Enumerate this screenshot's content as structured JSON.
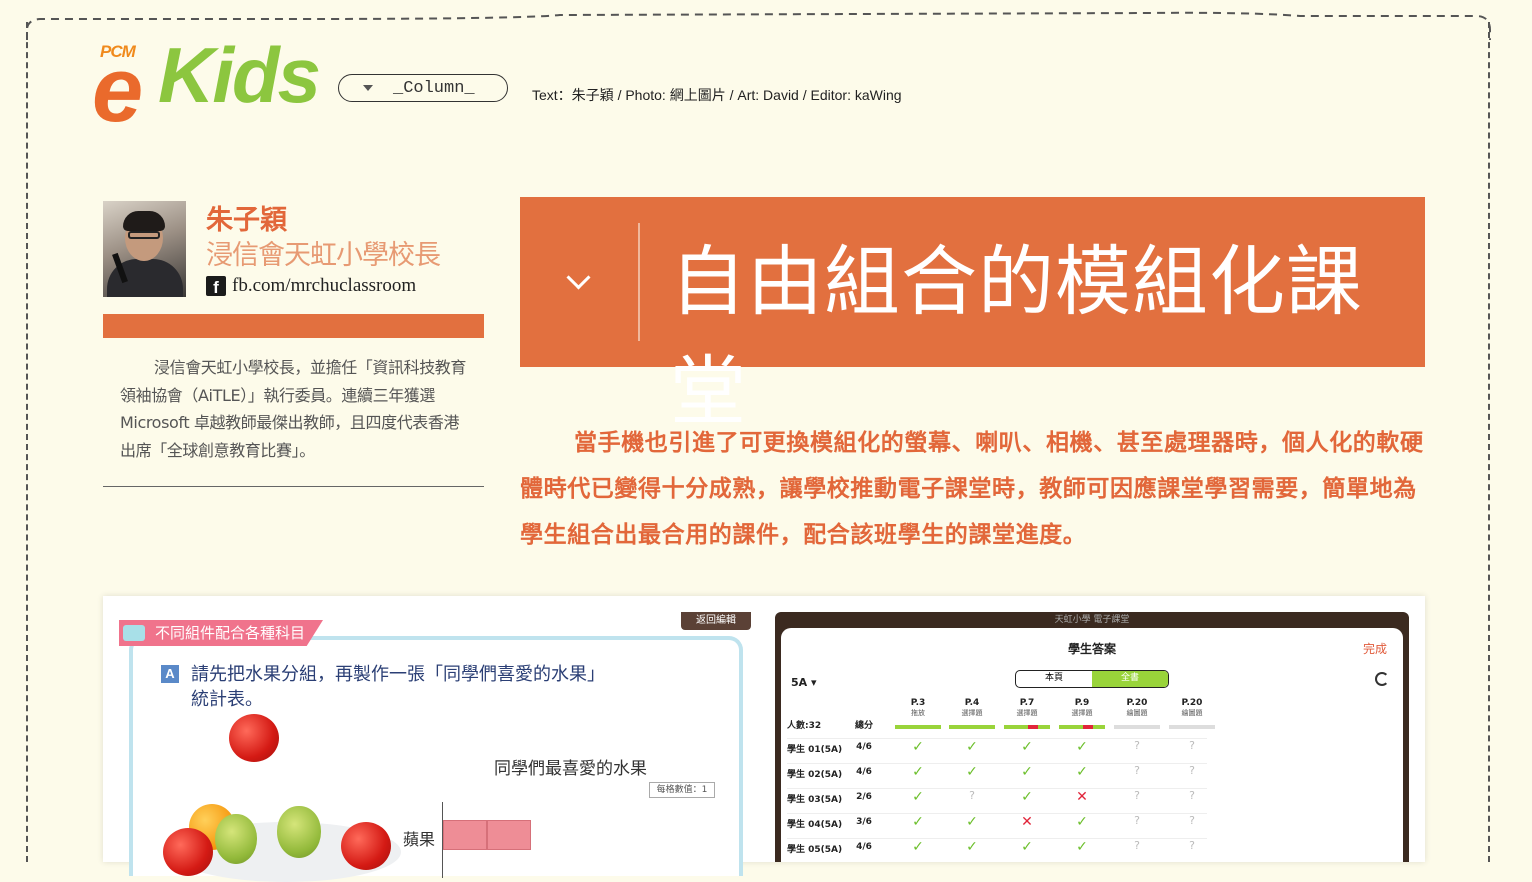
{
  "header": {
    "logo_prefix": "PCM",
    "logo_e": "e",
    "logo_kids": "Kids",
    "column_label": "_Column_",
    "credits": "Text：朱子穎 / Photo: 網上圖片 / Art: David / Editor: kaWing"
  },
  "author": {
    "name": "朱子穎",
    "role": "浸信會天虹小學校長",
    "fb_icon": "f",
    "fb_link": "fb.com/mrchuclassroom",
    "bio": "浸信會天虹小學校長，並擔任「資訊科技教育領袖協會（AiTLE）」執行委員。連續三年獲選 Microsoft 卓越教師最傑出教師，且四度代表香港出席「全球創意教育比賽」。"
  },
  "article": {
    "title": "自由組合的模組化課堂",
    "lead": "當手機也引進了可更換模組化的螢幕、喇叭、相機、甚至處理器時，個人化的軟硬體時代已變得十分成熟，讓學校推動電子課堂時，教師可因應課堂學習需要，簡單地為學生組合出最合用的課件，配合該班學生的課堂進度。"
  },
  "left_screenshot": {
    "tag": "不同組件配合各種科目",
    "back_button": "返回編輯",
    "badge": "A",
    "task": "請先把水果分組，再製作一張「同學們喜愛的水果」統計表。",
    "chart_title": "同學們最喜愛的水果",
    "chart_note": "每格數值：1",
    "bar_label": "蘋果"
  },
  "right_screenshot": {
    "top_bar": "天虹小學 電子課堂",
    "title": "學生答案",
    "done": "完成",
    "class_select": "5A ▾",
    "seg_left": "本頁",
    "seg_right": "全書",
    "count_label": "人數:32",
    "score_header": "總分",
    "columns": [
      {
        "page": "P.3",
        "type": "拖放"
      },
      {
        "page": "P.4",
        "type": "選擇題"
      },
      {
        "page": "P.7",
        "type": "選擇題"
      },
      {
        "page": "P.9",
        "type": "選擇題"
      },
      {
        "page": "P.20",
        "type": "繪圖題"
      },
      {
        "page": "P.20",
        "type": "繪圖題"
      }
    ],
    "rows": [
      {
        "name": "學生 01(5A)",
        "score": "4/6",
        "marks": [
          "tick",
          "tick",
          "tick",
          "tick",
          "q",
          "q"
        ]
      },
      {
        "name": "學生 02(5A)",
        "score": "4/6",
        "marks": [
          "tick",
          "tick",
          "tick",
          "tick",
          "q",
          "q"
        ]
      },
      {
        "name": "學生 03(5A)",
        "score": "2/6",
        "marks": [
          "tick",
          "q",
          "tick",
          "cross",
          "q",
          "q"
        ]
      },
      {
        "name": "學生 04(5A)",
        "score": "3/6",
        "marks": [
          "tick",
          "tick",
          "cross",
          "tick",
          "q",
          "q"
        ]
      },
      {
        "name": "學生 05(5A)",
        "score": "4/6",
        "marks": [
          "tick",
          "tick",
          "tick",
          "tick",
          "q",
          "q"
        ]
      }
    ]
  },
  "colors": {
    "accent": "#e2703f",
    "lead_text": "#e2673a",
    "green": "#8cc63f",
    "tag_pink": "#f0738c"
  }
}
